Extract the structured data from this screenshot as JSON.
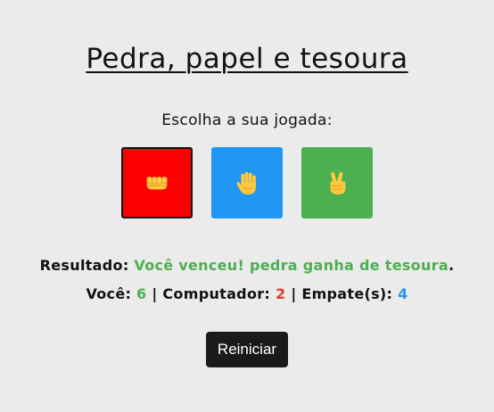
{
  "title": "Pedra, papel e tesoura",
  "prompt": "Escolha a sua jogada:",
  "choices": [
    {
      "name": "rock",
      "icon": "fist-icon",
      "color": "#ff0000"
    },
    {
      "name": "paper",
      "icon": "raised-hand-icon",
      "color": "#2196f3"
    },
    {
      "name": "scissors",
      "icon": "victory-hand-icon",
      "color": "#4caf50"
    }
  ],
  "result": {
    "label": "Resultado:",
    "message": "Você venceu! pedra ganha de tesoura",
    "suffix": ".",
    "message_color": "#4caf50"
  },
  "score": {
    "player_label": "Você:",
    "player_value": "6",
    "player_color": "#4caf50",
    "separator": "|",
    "computer_label": "Computador:",
    "computer_value": "2",
    "computer_color": "#e53935",
    "ties_label": "Empate(s):",
    "ties_value": "4",
    "ties_color": "#2196f3"
  },
  "reset_button": {
    "label": "Reiniciar",
    "color": "#1a1a1a"
  }
}
